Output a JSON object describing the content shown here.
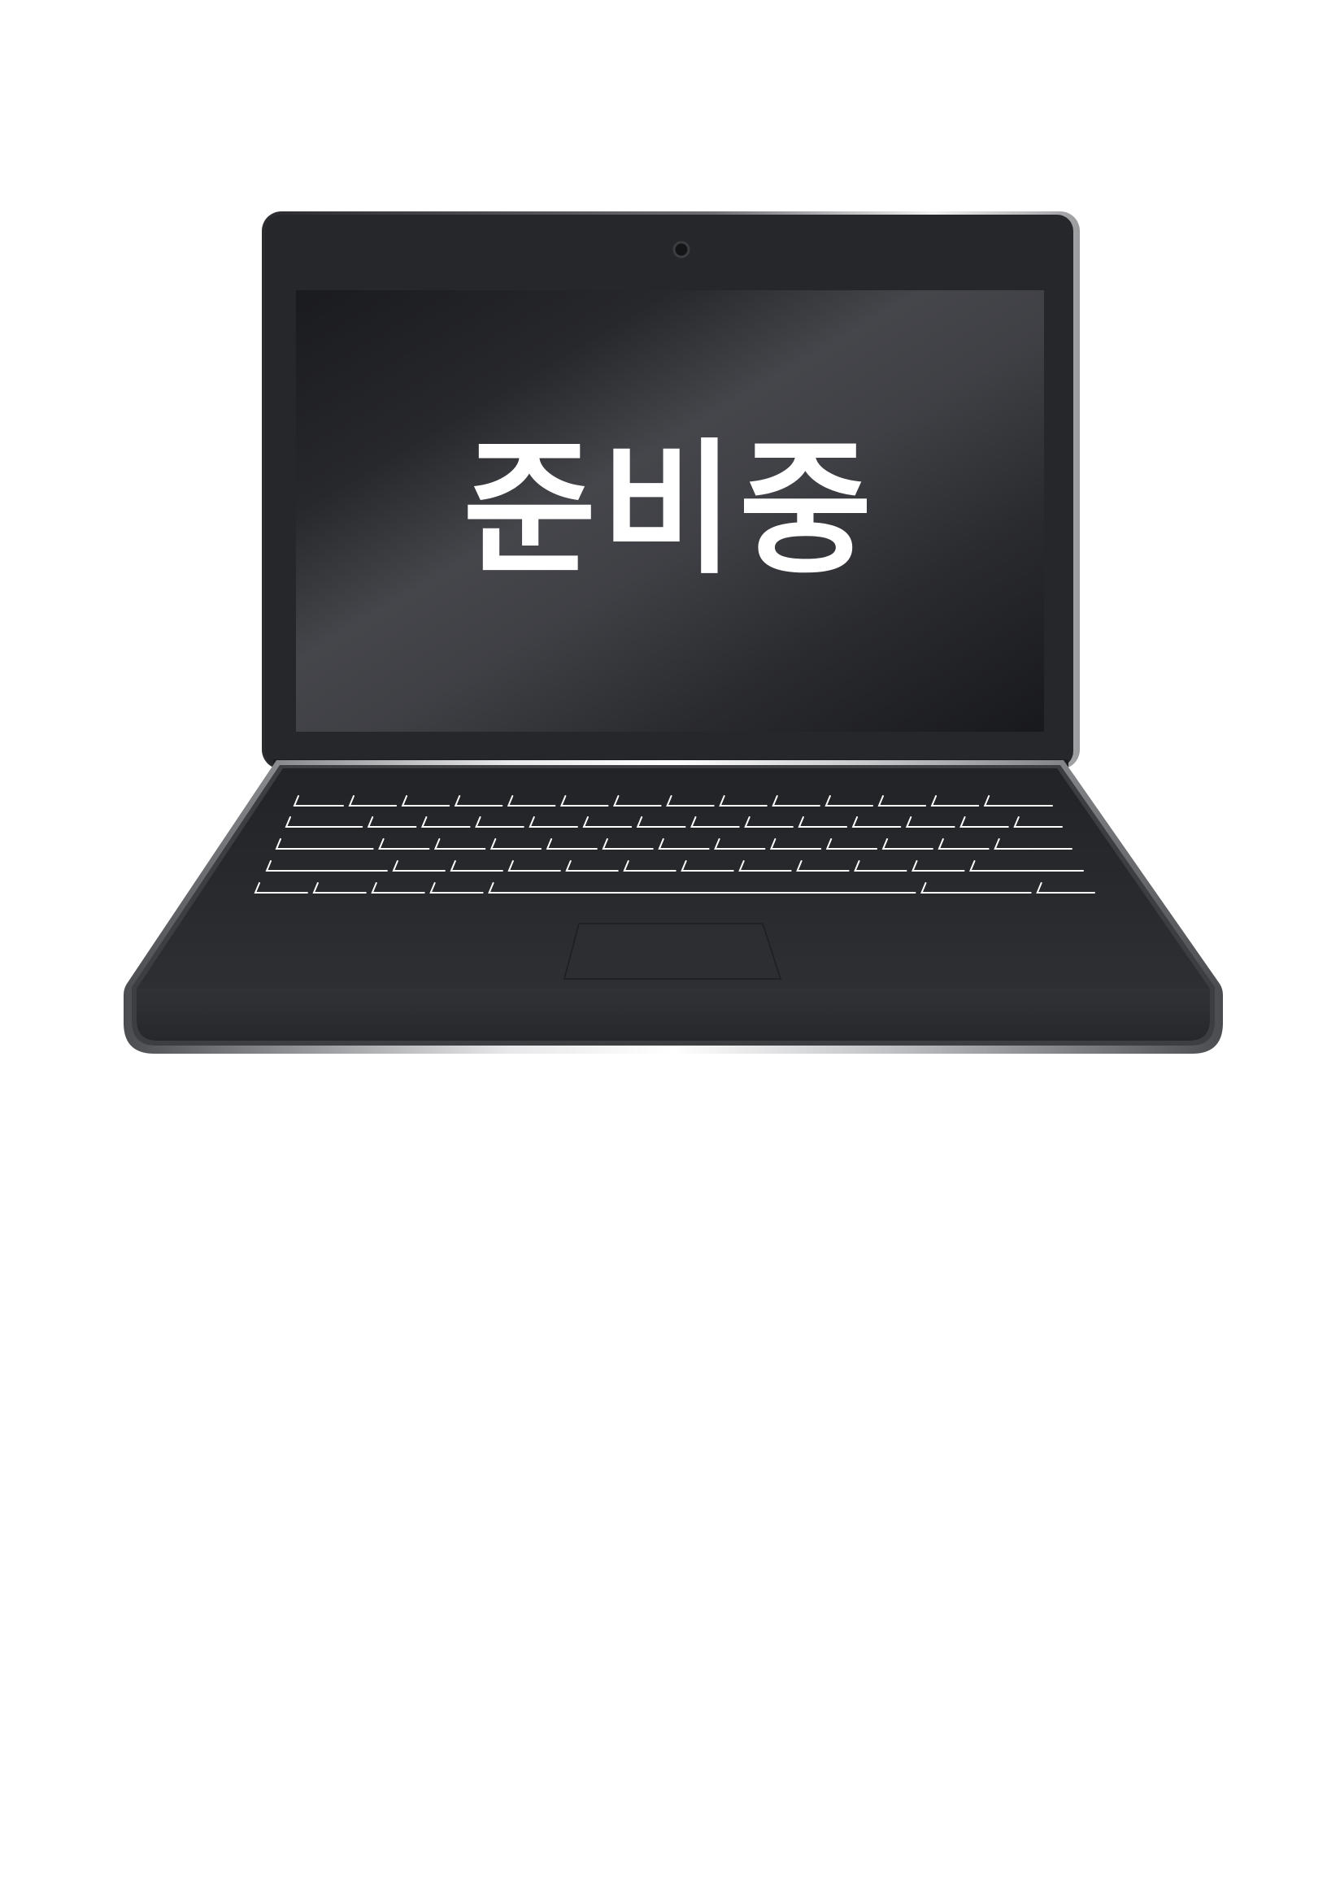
{
  "screen": {
    "message": "준비중"
  },
  "colors": {
    "background": "#ffffff",
    "body_dark": "#25272b",
    "screen_dark": "#1b1c20",
    "screen_glare": "#45464b",
    "bezel_silver": "#d7d8da",
    "key_line": "#ffffff"
  },
  "icons": {
    "camera": "webcam-icon"
  }
}
